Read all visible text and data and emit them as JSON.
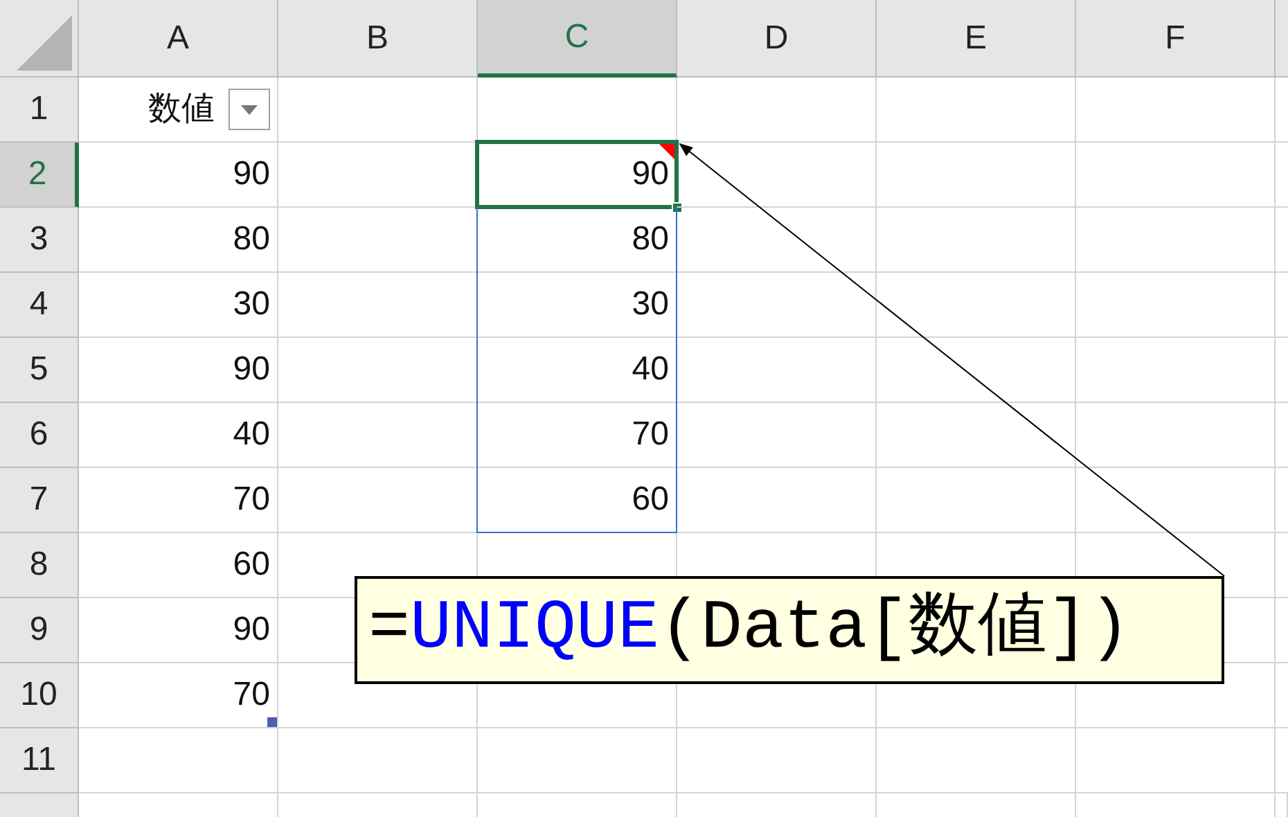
{
  "columns": [
    {
      "label": "A",
      "selected": false
    },
    {
      "label": "B",
      "selected": false
    },
    {
      "label": "C",
      "selected": true
    },
    {
      "label": "D",
      "selected": false
    },
    {
      "label": "E",
      "selected": false
    },
    {
      "label": "F",
      "selected": false
    }
  ],
  "rows": [
    {
      "label": "1",
      "selected": false,
      "a": "数値",
      "filter": true
    },
    {
      "label": "2",
      "selected": true,
      "a": "90",
      "c": "90",
      "active": true,
      "comment": true
    },
    {
      "label": "3",
      "selected": false,
      "a": "80",
      "c": "80"
    },
    {
      "label": "4",
      "selected": false,
      "a": "30",
      "c": "30"
    },
    {
      "label": "5",
      "selected": false,
      "a": "90",
      "c": "40"
    },
    {
      "label": "6",
      "selected": false,
      "a": "40",
      "c": "70"
    },
    {
      "label": "7",
      "selected": false,
      "a": "70",
      "c": "60"
    },
    {
      "label": "8",
      "selected": false,
      "a": "60"
    },
    {
      "label": "9",
      "selected": false,
      "a": "90"
    },
    {
      "label": "10",
      "selected": false,
      "a": "70",
      "table_end": true
    },
    {
      "label": "11",
      "selected": false
    }
  ],
  "callout": {
    "parts": [
      {
        "kind": "operator",
        "text": "="
      },
      {
        "kind": "function",
        "text": "UNIQUE"
      },
      {
        "kind": "plain",
        "text": "(Data[数値])"
      }
    ]
  }
}
